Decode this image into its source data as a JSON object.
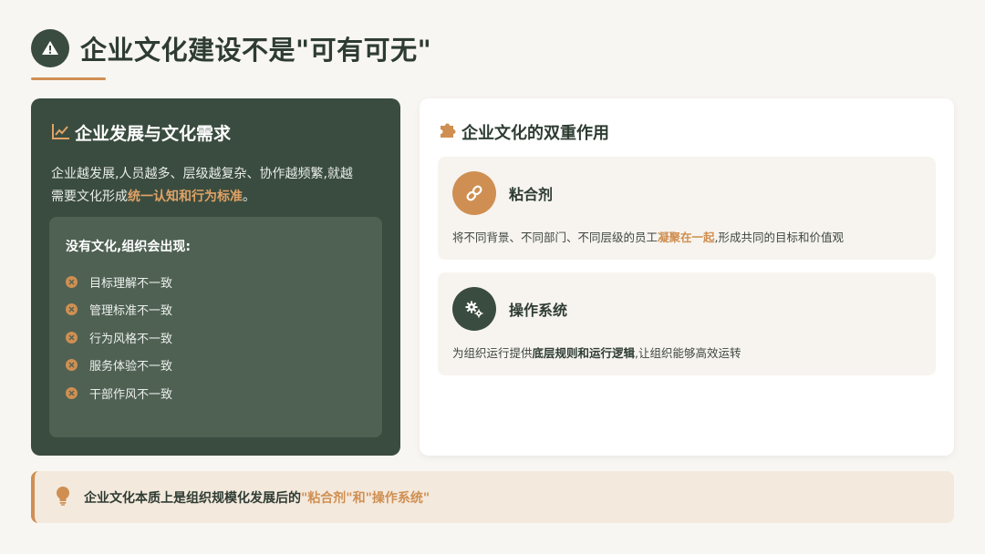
{
  "title": "企业文化建设不是\"可有可无\"",
  "left_card": {
    "heading": "企业发展与文化需求",
    "desc_line1": "企业越发展,人员越多、层级越复杂、协作越频繁,就越",
    "desc_line2_prefix": "需要文化形成",
    "desc_highlight": "统一认知和行为标准",
    "desc_line2_suffix": "。",
    "issues_title": "没有文化,组织会出现:",
    "issues": [
      "目标理解不一致",
      "管理标准不一致",
      "行为风格不一致",
      "服务体验不一致",
      "干部作风不一致"
    ]
  },
  "right_card": {
    "heading": "企业文化的双重作用",
    "roles": [
      {
        "name": "粘合剂",
        "desc_prefix": "将不同背景、不同部门、不同层级的员工",
        "desc_highlight": "凝聚在一起",
        "desc_suffix": ",形成共同的目标和价值观"
      },
      {
        "name": "操作系统",
        "desc_prefix": "为组织运行提供",
        "desc_highlight": "底层规则和运行逻辑",
        "desc_suffix": ",让组织能够高效运转"
      }
    ]
  },
  "bottom": {
    "prefix": "企业文化本质上是组织规模化发展后的",
    "highlight": "\"粘合剂\"和\"操作系统\""
  },
  "colors": {
    "dark_green": "#3a4c3f",
    "accent_orange": "#cf8f52",
    "background": "#f8f6f2"
  },
  "icons": {
    "title": "warning-icon",
    "left_heading": "chart-line-icon",
    "right_heading": "puzzle-icon",
    "role1": "link-icon",
    "role2": "gears-icon",
    "issue": "x-circle-icon",
    "bottom": "lightbulb-icon"
  }
}
